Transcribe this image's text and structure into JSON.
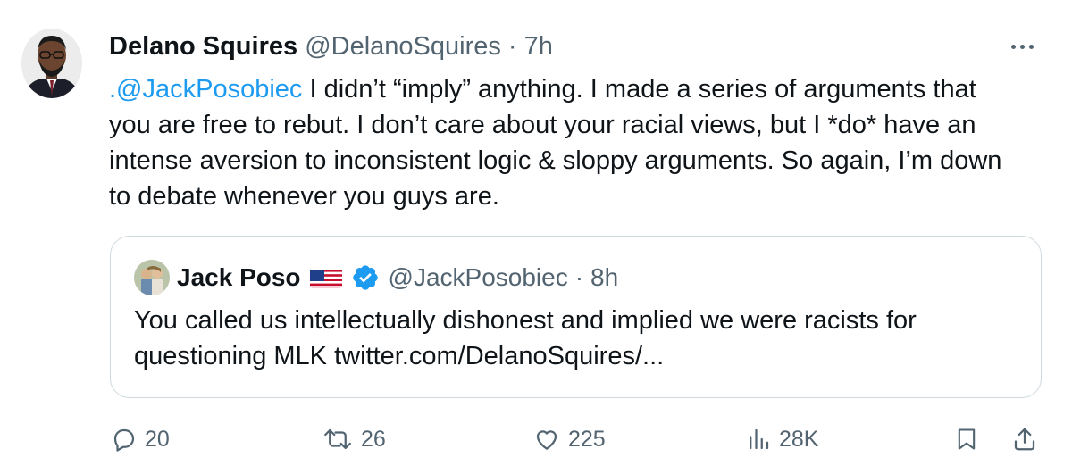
{
  "tweet": {
    "author_name": "Delano Squires",
    "author_handle": "@DelanoSquires",
    "separator": "·",
    "time": "7h",
    "mention": ".@JackPosobiec",
    "text": " I didn’t “imply” anything. I made a series of arguments that you are free to rebut. I don’t care about your racial views, but I *do* have an intense aversion to inconsistent logic & sloppy arguments. So again, I’m down to debate whenever you guys are.",
    "more_icon": "more-horizontal-icon"
  },
  "quote": {
    "author_name": "Jack Poso",
    "flag_icon": "us-flag-icon",
    "verified_icon": "verified-badge-icon",
    "author_handle": "@JackPosobiec",
    "separator": "·",
    "time": "8h",
    "text": "You called us intellectually dishonest and implied we were racists for questioning MLK twitter.com/DelanoSquires/..."
  },
  "actions": {
    "replies": "20",
    "retweets": "26",
    "likes": "225",
    "views": "28K"
  },
  "colors": {
    "mention": "#1d9bf0",
    "secondary_text": "#536471",
    "border": "#cfd9de",
    "verified": "#1d9bf0"
  }
}
